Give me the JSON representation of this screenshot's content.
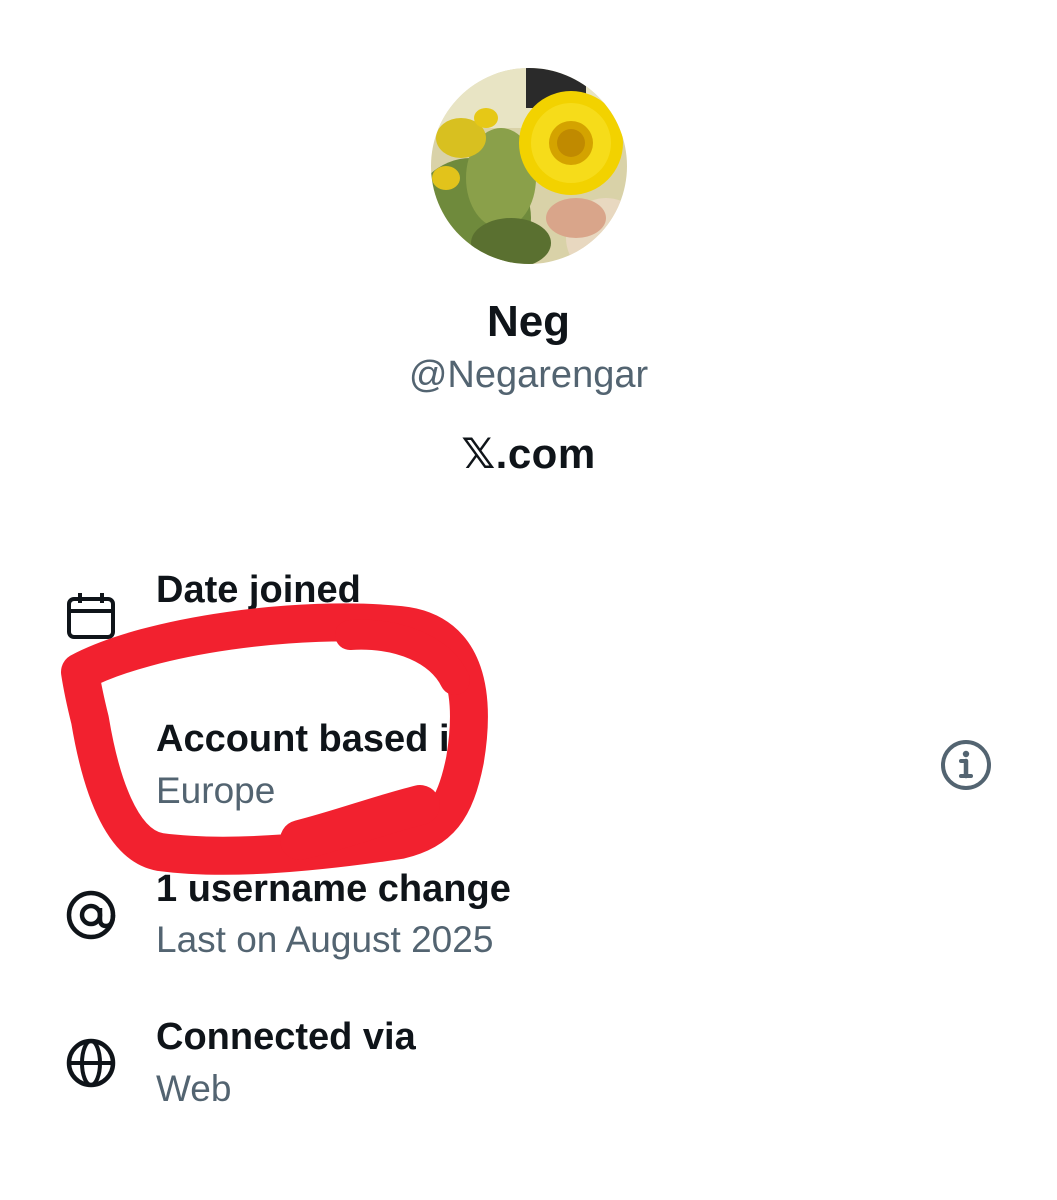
{
  "profile": {
    "display_name": "Neg",
    "handle": "@Negarengar",
    "brand": "𝕏.com",
    "avatar_alt": "sunflower-avatar"
  },
  "rows": [
    {
      "icon": "calendar-icon",
      "title": "Date joined",
      "value": ""
    },
    {
      "icon": "none",
      "title": "Account based i",
      "value": "Europe"
    },
    {
      "icon": "at-sign-icon",
      "title": "1 username change",
      "value": "Last on August 2025"
    },
    {
      "icon": "globe-icon",
      "title": "Connected via",
      "value": "Web"
    }
  ],
  "colors": {
    "text_primary": "#0f1419",
    "text_secondary": "#536471",
    "annotation_red": "#f2212f"
  }
}
